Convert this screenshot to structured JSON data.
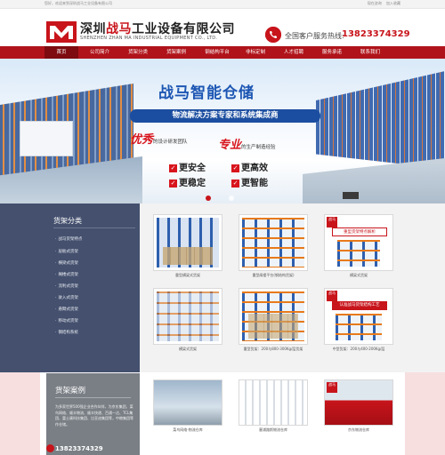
{
  "topbar": {
    "welcome": "您好，欢迎来到深圳战马工业设备有限公司",
    "links": [
      "现在咨询",
      "加入收藏"
    ]
  },
  "header": {
    "company_name_prefix": "深圳",
    "company_name_highlight": "战马",
    "company_name_suffix": "工业设备有限公司",
    "company_name_en": "SHENZHEN ZHAN MA INDUSTRIAL EQUIPMENT CO., LTD.",
    "hotline_label": "全国客户服务热线:",
    "hotline_number": "13823374329"
  },
  "nav": {
    "items": [
      "首页",
      "公司简介",
      "货架分类",
      "货架案例",
      "钢结构平台",
      "非标定制",
      "人才招聘",
      "服务承诺",
      "联系我们"
    ],
    "active_index": 0
  },
  "banner": {
    "title": "战马智能仓储",
    "subtitle": "物流解决方案专家和系统集成商",
    "feature_1_big": "优秀",
    "feature_1_small": "的设计研发团队",
    "feature_2_big": "专业",
    "feature_2_small": "的生产制造经验",
    "checks": [
      "更安全",
      "更高效",
      "更稳定",
      "更智能"
    ],
    "slide_count": 2,
    "active_slide": 0
  },
  "products": {
    "section_title": "货架分类",
    "categories": [
      "战马货架特点",
      "层板式货架",
      "横梁式货架",
      "阁楼式货架",
      "流利式货架",
      "驶入式货架",
      "悬臂式货架",
      "移动式货架",
      "钢结构系统"
    ],
    "items": [
      {
        "caption": "重型横梁式货架"
      },
      {
        "caption": "重型阁楼平台(钢结构货架)"
      },
      {
        "caption": "横梁式货架",
        "badge": "战马",
        "promo": "重型货架特点解析"
      },
      {
        "caption": "横梁式货架"
      },
      {
        "caption": "重型货架：200与800-300Kg/层货架"
      },
      {
        "caption": "中型货架：200与400-200Kg/层",
        "badge": "战马",
        "promo": "认准战马货架结构工艺"
      }
    ]
  },
  "cases": {
    "section_title": "货架案例",
    "description": "为多家世界500强企业合作伙伴，为京东集团、菜鸟网络、顺丰物流、顺丰快递、百通一达、TCL集团、富士康科技集团、比亚迪集团等，中粮集团等作仓储。",
    "phone": "13823374329",
    "items": [
      {
        "caption": "菜鸟网络-物流仓库"
      },
      {
        "caption": "塞浦路斯物流仓库"
      },
      {
        "caption": "京东物流仓库",
        "badge": "战马"
      }
    ]
  },
  "colors": {
    "brand_red": "#c8141b",
    "nav_bg": "#b0131a",
    "side_panel": "#44506e",
    "banner_blue": "#1d56b3"
  }
}
